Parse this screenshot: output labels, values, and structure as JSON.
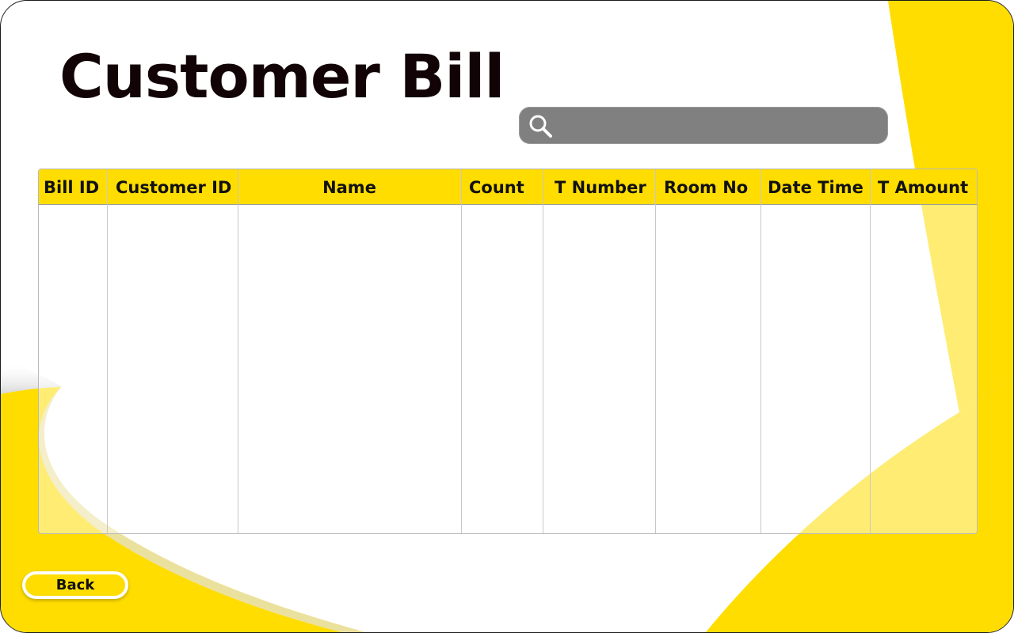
{
  "page": {
    "title": "Customer Bill"
  },
  "search": {
    "value": "",
    "placeholder": "",
    "icon": "search-icon"
  },
  "bill_table": {
    "columns": [
      {
        "key": "bill_id",
        "label": "Bill ID"
      },
      {
        "key": "customer_id",
        "label": "Customer ID"
      },
      {
        "key": "name",
        "label": "Name"
      },
      {
        "key": "count",
        "label": "Count"
      },
      {
        "key": "t_number",
        "label": "T Number"
      },
      {
        "key": "room_no",
        "label": "Room No"
      },
      {
        "key": "date_time",
        "label": "Date Time"
      },
      {
        "key": "t_amount",
        "label": "T Amount"
      }
    ],
    "rows": []
  },
  "back_button": {
    "label": "Back"
  },
  "colors": {
    "accent": "#ffdd00",
    "search_bg": "#808080",
    "title_text": "#120406"
  }
}
